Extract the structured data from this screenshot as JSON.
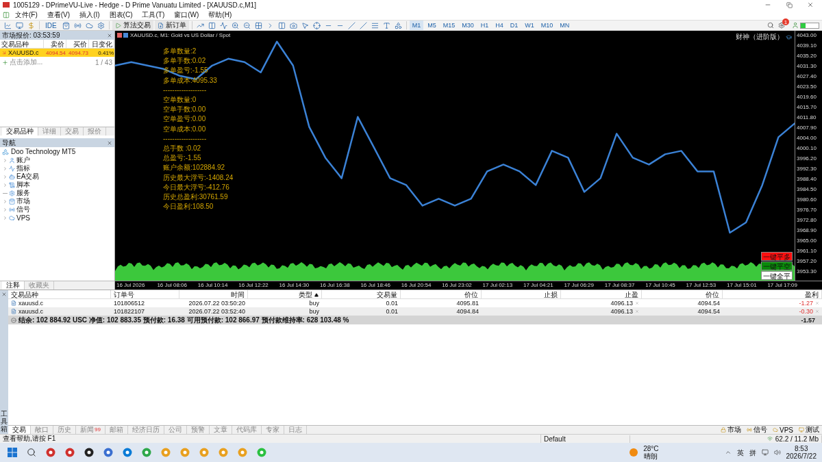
{
  "window": {
    "title": "1005129 - DPrimeVU-Live - Hedge - D Prime Vanuatu Limited - [XAUUSD.c,M1]"
  },
  "menu": [
    "文件(F)",
    "查看(V)",
    "插入(I)",
    "图表(C)",
    "工具(T)",
    "窗口(W)",
    "帮助(H)"
  ],
  "toolbar": {
    "ide": "IDE",
    "algo_trading": "算法交易",
    "new_order": "新订单",
    "timeframes": [
      {
        "label": "M1",
        "selected": true
      },
      {
        "label": "M5",
        "selected": false
      },
      {
        "label": "M15",
        "selected": false
      },
      {
        "label": "M30",
        "selected": false
      },
      {
        "label": "H1",
        "selected": false
      },
      {
        "label": "H4",
        "selected": false
      },
      {
        "label": "D1",
        "selected": false
      },
      {
        "label": "W1",
        "selected": false
      },
      {
        "label": "M10",
        "selected": false
      },
      {
        "label": "MN",
        "selected": false
      }
    ],
    "notification_badge": "1"
  },
  "market_watch": {
    "title": "市场报价: 03:53:59",
    "columns": [
      "交易品种",
      "卖价",
      "买价",
      "日变化"
    ],
    "rows": [
      {
        "symbol": "XAUUSD.c",
        "bid": "4094.54",
        "ask": "4094.73",
        "change": "0.41%",
        "selected": true
      }
    ],
    "add_label": "点击添加...",
    "count": "1 / 43",
    "tabs": [
      {
        "label": "交易品种",
        "selected": true
      },
      {
        "label": "详细",
        "selected": false
      },
      {
        "label": "交易",
        "selected": false
      },
      {
        "label": "报价",
        "selected": false
      }
    ]
  },
  "navigator": {
    "title": "导航",
    "root": "Doo Technology MT5",
    "items": [
      {
        "label": "账户",
        "expandable": true
      },
      {
        "label": "指标",
        "expandable": true
      },
      {
        "label": "EA交易",
        "expandable": true
      },
      {
        "label": "脚本",
        "expandable": true
      },
      {
        "label": "服务",
        "expandable": false
      },
      {
        "label": "市场",
        "expandable": true
      },
      {
        "label": "信号",
        "expandable": true
      },
      {
        "label": "VPS",
        "expandable": true
      }
    ],
    "tabs": [
      {
        "label": "注释",
        "selected": true
      },
      {
        "label": "收藏夹",
        "selected": false
      }
    ]
  },
  "chart": {
    "header": "XAUUSD.c, M1:  Gold vs US Dollar / Spot",
    "ea_name": "财神（进阶版）",
    "info_lines": [
      "多单数量:2",
      "多单手数:0.02",
      "多单盈亏:-1.55",
      "多单成本:4095.33",
      "-------------------",
      "空单数量:0",
      "空单手数:0.00",
      "空单盈亏:0.00",
      "空单成本:0.00",
      "-------------------",
      "总手数 :0.02",
      "总盈亏:-1.55",
      "账户余额:102884.92",
      "历史最大浮亏:-1408.24",
      "今日最大浮亏:-412.76",
      "历史总盈利:30761.59",
      "今日盈利:108.50"
    ],
    "buttons": [
      {
        "label": "一键平多",
        "kind": "close_buy"
      },
      {
        "label": "一键平空",
        "kind": "close_sell"
      },
      {
        "label": "一键全平",
        "kind": "close_all"
      }
    ],
    "time_labels": [
      "16 Jul 2026",
      "16 Jul 08:06",
      "16 Jul 10:14",
      "16 Jul 12:22",
      "16 Jul 14:30",
      "16 Jul 16:38",
      "16 Jul 18:46",
      "16 Jul 20:54",
      "16 Jul 23:02",
      "17 Jul 02:13",
      "17 Jul 04:21",
      "17 Jul 06:29",
      "17 Jul 08:37",
      "17 Jul 10:45",
      "17 Jul 12:53",
      "17 Jul 15:01",
      "17 Jul 17:09"
    ],
    "chart_data": {
      "type": "line",
      "ylim": [
        3949.9,
        4044.8
      ],
      "yticks": [
        {
          "value": 4043.0,
          "label": "4043.00"
        },
        {
          "value": 4039.1,
          "label": "4039.10"
        },
        {
          "value": 4035.2,
          "label": "4035.20"
        },
        {
          "value": 4031.3,
          "label": "4031.30"
        },
        {
          "value": 4027.4,
          "label": "4027.40"
        },
        {
          "value": 4023.5,
          "label": "4023.50"
        },
        {
          "value": 4019.6,
          "label": "4019.60"
        },
        {
          "value": 4015.7,
          "label": "4015.70"
        },
        {
          "value": 4011.8,
          "label": "4011.80"
        },
        {
          "value": 4007.9,
          "label": "4007.90"
        },
        {
          "value": 4004.0,
          "label": "4004.00"
        },
        {
          "value": 4000.1,
          "label": "4000.10"
        },
        {
          "value": 3996.2,
          "label": "3996.20"
        },
        {
          "value": 3992.3,
          "label": "3992.30"
        },
        {
          "value": 3988.4,
          "label": "3988.40"
        },
        {
          "value": 3984.5,
          "label": "3984.50"
        },
        {
          "value": 3980.6,
          "label": "3980.60"
        },
        {
          "value": 3976.7,
          "label": "3976.70"
        },
        {
          "value": 3972.8,
          "label": "3972.80"
        },
        {
          "value": 3968.9,
          "label": "3968.90"
        },
        {
          "value": 3965.0,
          "label": "3965.00"
        },
        {
          "value": 3961.1,
          "label": "3961.10"
        },
        {
          "value": 3957.2,
          "label": "3957.20"
        },
        {
          "value": 3953.3,
          "label": "3953.30"
        }
      ],
      "series": [
        {
          "color": "#3b82d6",
          "values": [
            4031.6,
            4032.9,
            4031.6,
            4030.3,
            4027.7,
            4026.4,
            4031.6,
            4034.2,
            4032.9,
            4029.0,
            4040.7,
            4031.6,
            4008.3,
            3996.6,
            3988.8,
            4012.1,
            4000.5,
            3988.8,
            3986.2,
            3978.4,
            3981.0,
            3978.4,
            3981.0,
            3991.4,
            3994.0,
            3991.4,
            3986.2,
            3999.2,
            3996.6,
            3983.6,
            3988.8,
            4005.7,
            3996.6,
            3994.0,
            3997.9,
            3999.2,
            3991.4,
            3991.4,
            3968.1,
            3972.0,
            3986.2,
            4004.4,
            4009.6
          ]
        }
      ]
    }
  },
  "trades": {
    "columns": [
      "交易品种",
      "订单号",
      "时间",
      "类型",
      "交易量",
      "价位",
      "止损",
      "止盈",
      "价位",
      "盈利"
    ],
    "rows": [
      {
        "symbol": "xauusd.c",
        "order": "101806512",
        "time": "2026.07.22 03:50:20",
        "type": "buy",
        "volume": "0.01",
        "price": "4095.81",
        "tp": "4096.13",
        "current": "4094.54",
        "profit": "-1.27"
      },
      {
        "symbol": "xauusd.c",
        "order": "101822107",
        "time": "2026.07.22 03:52:40",
        "type": "buy",
        "volume": "0.01",
        "price": "4094.84",
        "tp": "4096.13",
        "current": "4094.54",
        "profit": "-0.30"
      }
    ],
    "summary": "结余: 102 884.92 USC  净值: 102 883.35  预付款: 16.38  可用预付款: 102 866.97  预付款维持率: 628 103.48 %",
    "summary_profit": "-1.57"
  },
  "toolbox_label": "工具箱",
  "bottom_tabs": [
    {
      "label": "交易",
      "selected": true
    },
    {
      "label": "敞口",
      "selected": false
    },
    {
      "label": "历史",
      "selected": false
    },
    {
      "label": "新闻",
      "selected": false,
      "badge": "99"
    },
    {
      "label": "邮箱",
      "selected": false
    },
    {
      "label": "经济日历",
      "selected": false
    },
    {
      "label": "公司",
      "selected": false
    },
    {
      "label": "预警",
      "selected": false
    },
    {
      "label": "文章",
      "selected": false
    },
    {
      "label": "代码库",
      "selected": false
    },
    {
      "label": "专家",
      "selected": false
    },
    {
      "label": "日志",
      "selected": false
    }
  ],
  "bottom_links": [
    "市场",
    "信号",
    "VPS",
    "测试"
  ],
  "status_bar": {
    "help": "查看帮助,请按 F1",
    "profile": "Default",
    "traffic": "62.2 / 11.2 Mb"
  },
  "taskbar": {
    "temperature": "28°C",
    "weather": "晴朗",
    "ime": [
      "英",
      "拼"
    ],
    "time": "8:53",
    "date": "2026/7/22"
  }
}
